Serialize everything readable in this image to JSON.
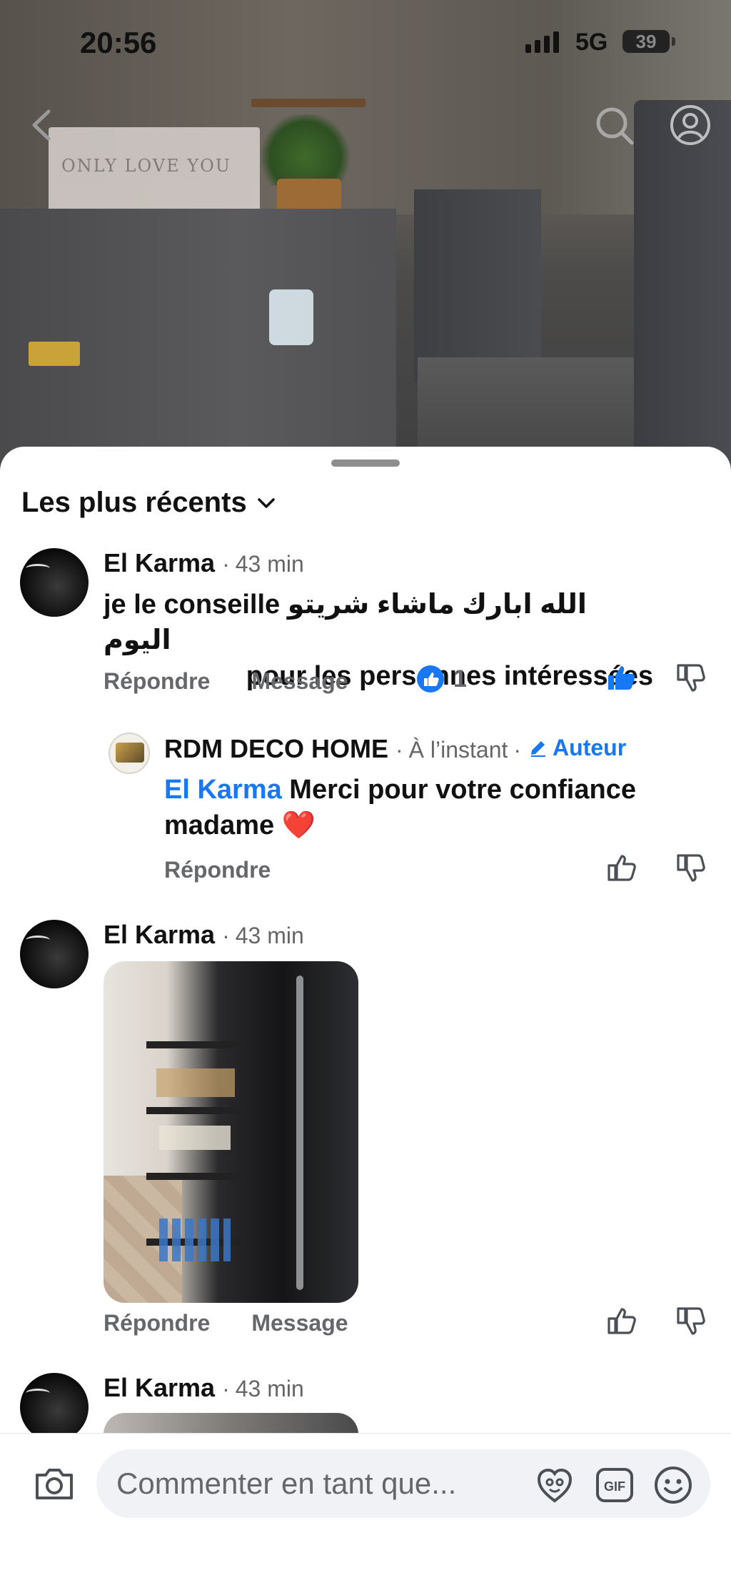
{
  "status_bar": {
    "time": "20:56",
    "network": "5G",
    "battery": "39"
  },
  "background_video": {
    "bag_text": "ONLY LOVE YOU"
  },
  "sheet": {
    "sort_label": "Les plus récents",
    "comments": [
      {
        "author": "El Karma",
        "time": "43 min",
        "text_line1": "je le conseille الله ابارك ماشاء شريتو اليوم",
        "text_line2": "pour les personnes intéressées",
        "reply_label": "Répondre",
        "message_label": "Message",
        "reaction_count": "1"
      },
      {
        "author": "RDM DECO HOME",
        "time": "À l’instant",
        "badge": "Auteur",
        "mention": "El Karma",
        "text_rest": " Merci pour votre confiance",
        "text_line2": "madame ❤️",
        "reply_label": "Répondre"
      },
      {
        "author": "El Karma",
        "time": "43 min",
        "reply_label": "Répondre",
        "message_label": "Message"
      },
      {
        "author": "El Karma",
        "time": "43 min"
      }
    ]
  },
  "composer": {
    "placeholder": "Commenter en tant que..."
  },
  "colors": {
    "accent": "#1877f2",
    "text": "#111111",
    "muted": "#65676b",
    "heart": "#e0245e"
  },
  "icons": [
    "back-icon",
    "search-icon",
    "profile-icon",
    "chevron-down-icon",
    "like-reaction-icon",
    "thumbs-up-icon",
    "thumbs-down-icon",
    "pencil-icon",
    "camera-icon",
    "avatar-sticker-icon",
    "gif-icon",
    "emoji-icon"
  ]
}
